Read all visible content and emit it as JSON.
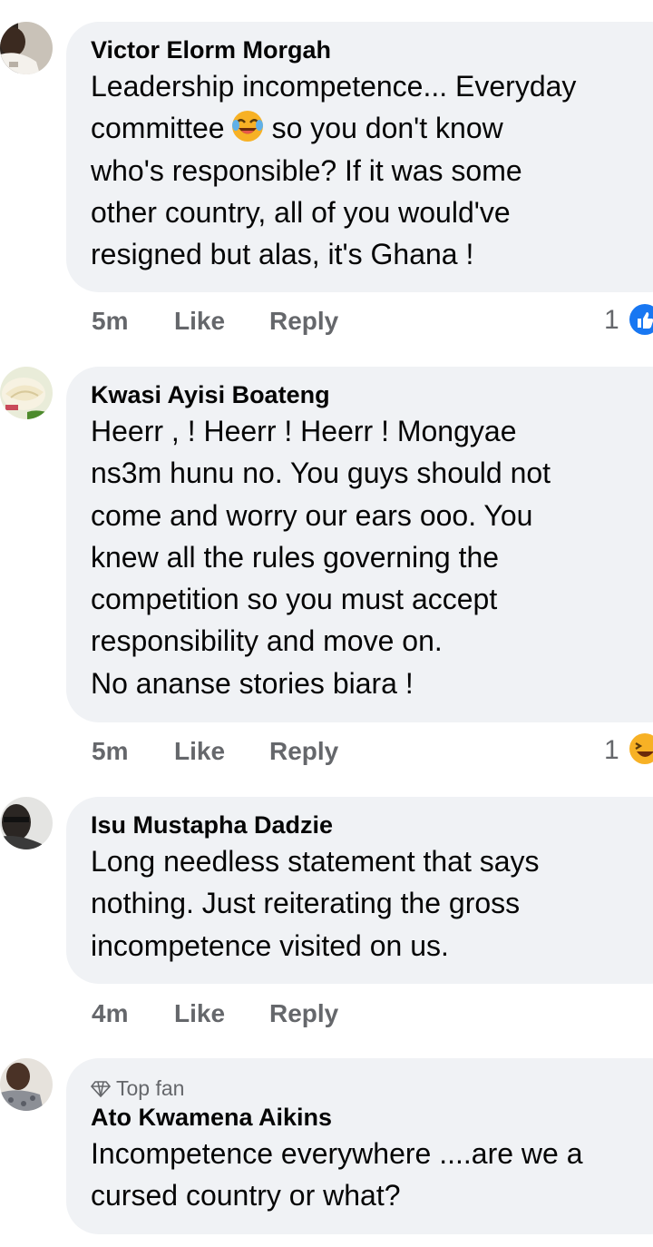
{
  "comments": [
    {
      "author": "Victor Elorm Morgah",
      "lines": [
        "Leadership incompetence... Everyday",
        "so you don't know",
        "who's responsible? If it was some",
        "other country, all of you would've",
        "resigned but alas, it's Ghana !"
      ],
      "line2_prefix": "committee",
      "time": "5m",
      "like_label": "Like",
      "reply_label": "Reply",
      "reaction_count": "1",
      "reaction_icon": "like-icon"
    },
    {
      "author": "Kwasi Ayisi Boateng",
      "lines": [
        "Heerr , ! Heerr ! Heerr ! Mongyae",
        "ns3m hunu no. You guys should not",
        "come and worry our ears ooo. You",
        "knew all the rules governing the",
        "competition so you must accept",
        "responsibility and move on.",
        "No ananse stories biara !"
      ],
      "time": "5m",
      "like_label": "Like",
      "reply_label": "Reply",
      "reaction_count": "1",
      "reaction_icon": "haha-icon"
    },
    {
      "author": "Isu Mustapha Dadzie",
      "lines": [
        "Long needless statement that says",
        "nothing. Just reiterating the gross",
        "incompetence visited on us."
      ],
      "time": "4m",
      "like_label": "Like",
      "reply_label": "Reply"
    },
    {
      "badge": "Top fan",
      "author": "Ato Kwamena Aikins",
      "lines": [
        "Incompetence everywhere ....are we a",
        "cursed country or what?"
      ]
    }
  ],
  "colors": {
    "bubble": "#f0f2f5",
    "meta": "#65676b",
    "like_blue": "#1877f2",
    "haha_yellow": "#f7b125"
  }
}
